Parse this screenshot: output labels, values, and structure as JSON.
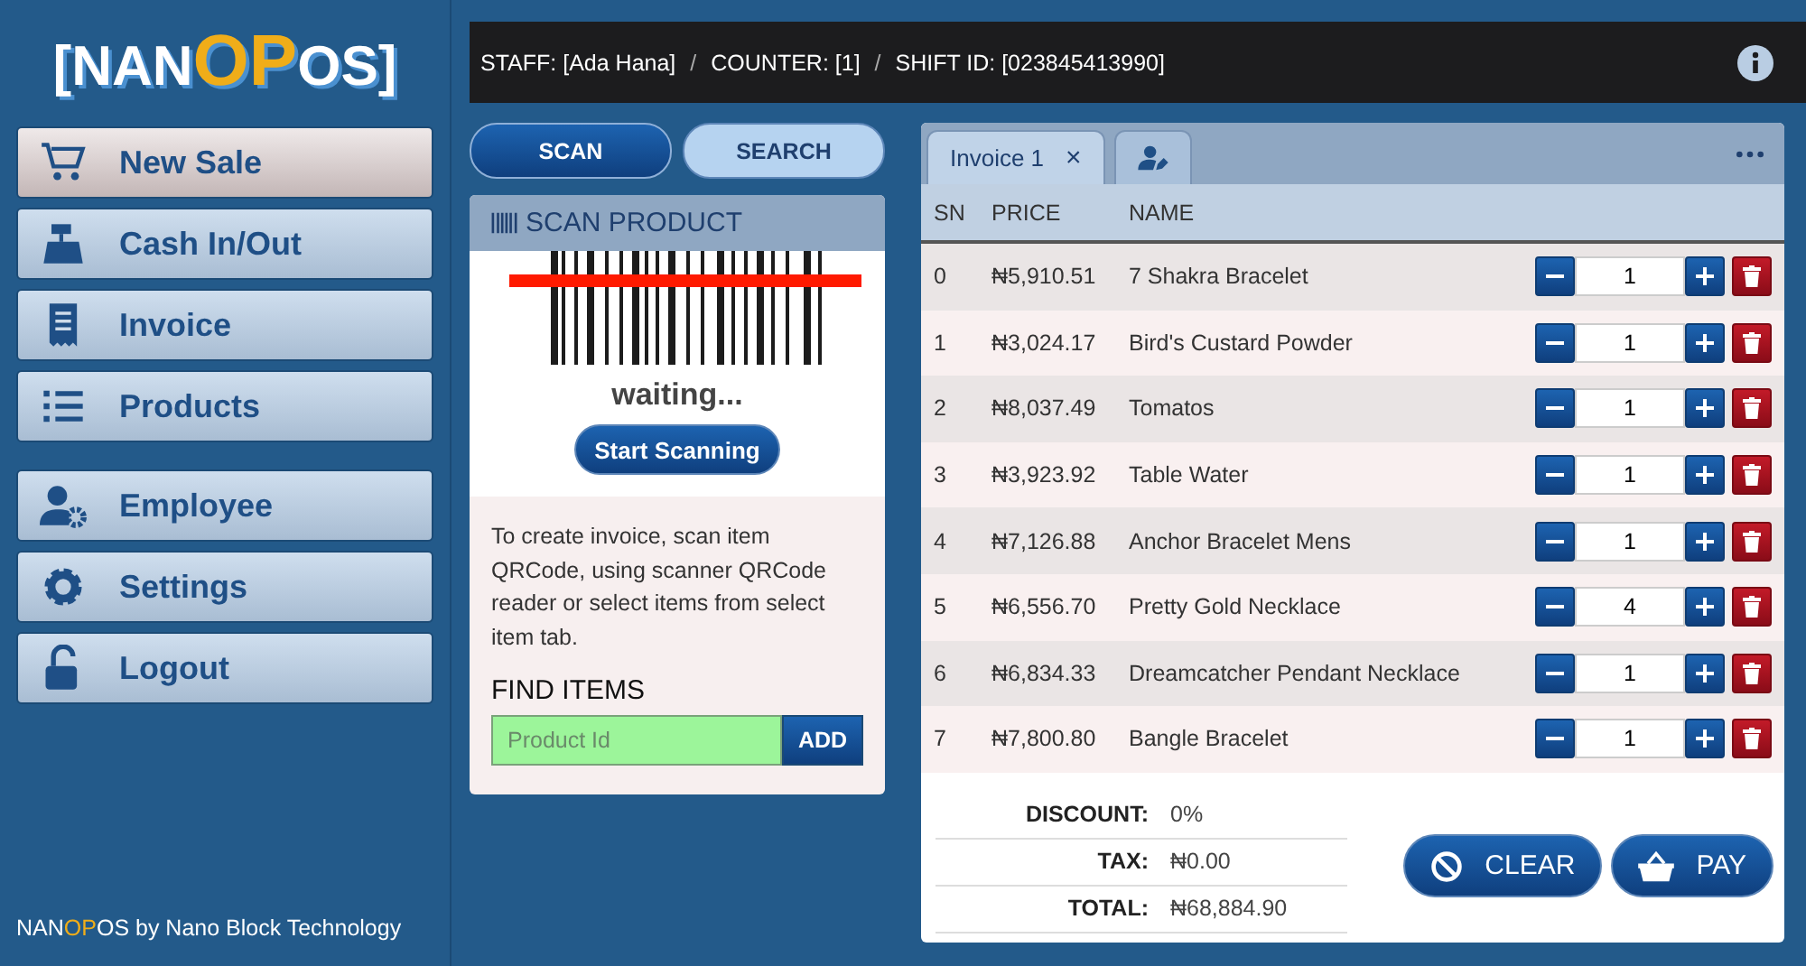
{
  "sidebar": {
    "logo": [
      {
        "text": "[NAN",
        "accent": false
      },
      {
        "text": "OP",
        "accent": true
      },
      {
        "text": "OS]",
        "accent": false
      }
    ],
    "menu_groups": [
      [
        {
          "label": "New Sale",
          "selected": true
        },
        {
          "label": "Cash In/Out",
          "selected": false
        },
        {
          "label": "Invoice",
          "selected": false
        },
        {
          "label": "Products",
          "selected": false
        }
      ],
      [
        {
          "label": "Employee",
          "selected": false
        },
        {
          "label": "Settings",
          "selected": false
        },
        {
          "label": "Logout",
          "selected": false
        }
      ]
    ],
    "footer": [
      {
        "text": "NAN",
        "accent": false
      },
      {
        "text": "OP",
        "accent": true
      },
      {
        "text": "OS by Nano Block Technology",
        "accent": false
      }
    ]
  },
  "info_bar": {
    "items": [
      "STAFF: [Ada Hana]",
      "COUNTER: [1]",
      "SHIFT ID: [023845413990]"
    ],
    "separators": [
      "/",
      "/"
    ]
  },
  "mode_tabs": [
    {
      "label": "SCAN",
      "selected": true
    },
    {
      "label": "SEARCH",
      "selected": false
    }
  ],
  "scan_panel": {
    "title": "SCAN PRODUCT",
    "status": "waiting...",
    "start_button": "Start Scanning",
    "help": "To create invoice, scan item QRCode, using scanner QRCode reader or select items from select item tab.",
    "find_title": "FIND ITEMS",
    "find_placeholder": "Product Id",
    "add_button": "ADD"
  },
  "invoice_tabs": [
    {
      "label": "Invoice 1",
      "close": "×",
      "selected": true
    },
    {
      "kind": "icon",
      "selected": false
    }
  ],
  "table": {
    "columns": [
      "SN",
      "PRICE",
      "NAME"
    ],
    "rows": [
      {
        "sn": "0",
        "price": "₦5,910.51",
        "name": "7 Shakra Bracelet",
        "quantity": "1"
      },
      {
        "sn": "1",
        "price": "₦3,024.17",
        "name": "Bird's Custard Powder",
        "quantity": "1"
      },
      {
        "sn": "2",
        "price": "₦8,037.49",
        "name": "Tomatos",
        "quantity": "1"
      },
      {
        "sn": "3",
        "price": "₦3,923.92",
        "name": "Table Water",
        "quantity": "1"
      },
      {
        "sn": "4",
        "price": "₦7,126.88",
        "name": "Anchor Bracelet Mens",
        "quantity": "1"
      },
      {
        "sn": "5",
        "price": "₦6,556.70",
        "name": "Pretty Gold Necklace",
        "quantity": "4"
      },
      {
        "sn": "6",
        "price": "₦6,834.33",
        "name": "Dreamcatcher Pendant Necklace",
        "quantity": "1"
      },
      {
        "sn": "7",
        "price": "₦7,800.80",
        "name": "Bangle Bracelet",
        "quantity": "1"
      }
    ]
  },
  "summary": [
    {
      "label": "DISCOUNT:",
      "value": "0%"
    },
    {
      "label": "TAX:",
      "value": "₦0.00"
    },
    {
      "label": "TOTAL:",
      "value": "₦68,884.90"
    }
  ],
  "actions": [
    {
      "kind": "clear",
      "label": "CLEAR"
    },
    {
      "kind": "pay",
      "label": "PAY"
    }
  ]
}
